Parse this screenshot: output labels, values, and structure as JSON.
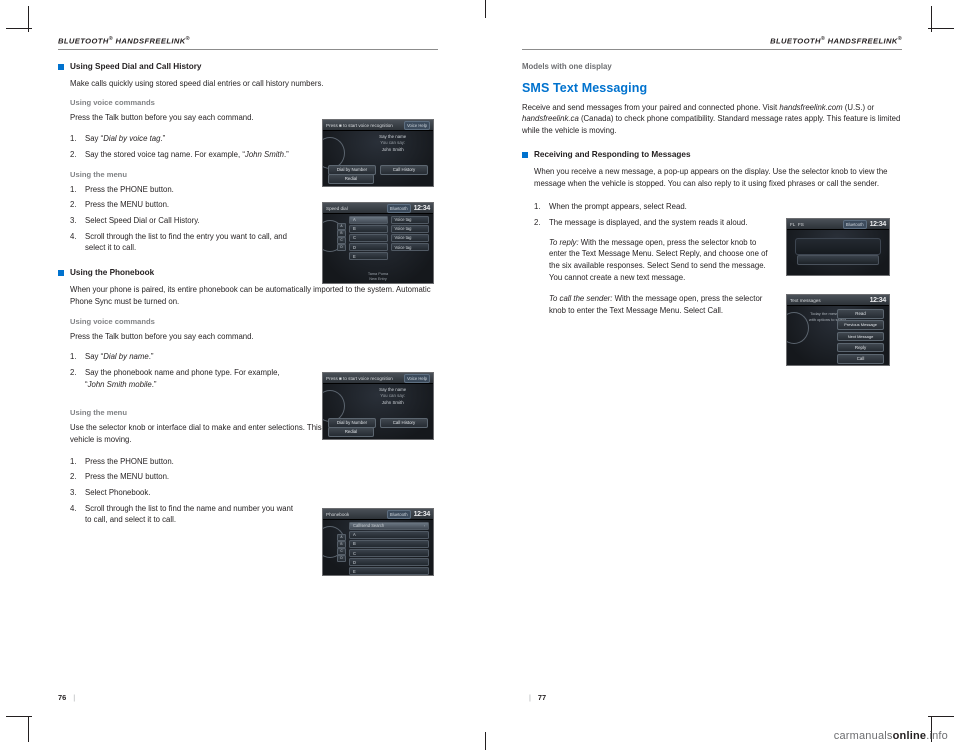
{
  "header": {
    "left": "BLUETOOTH",
    "left_sup": "®",
    "left_rest": " HANDSFREELINK",
    "left_sup2": "®",
    "right": "BLUETOOTH",
    "right_sup": "®",
    "right_rest": " HANDSFREELINK",
    "right_sup2": "®"
  },
  "left_page": {
    "folio": "76",
    "folio_bar": "|",
    "s1": {
      "title": "Using Speed Dial and Call History",
      "intro": "Make calls quickly using stored speed dial entries or call history numbers.",
      "voice_label": "Using voice commands",
      "voice_intro": "Press the Talk button before you say each command.",
      "voice_steps": [
        {
          "num": "1.",
          "pre": "Say “",
          "ital": "Dial by voice tag",
          "post": ".”"
        },
        {
          "num": "2.",
          "pre": "Say the stored voice tag name. For example, “",
          "ital": "John Smith",
          "post": ".”"
        }
      ],
      "menu_label": "Using the menu",
      "menu_steps": [
        {
          "num": "1.",
          "text": "Press the PHONE button."
        },
        {
          "num": "2.",
          "text": "Press the MENU button."
        },
        {
          "num": "3.",
          "text": "Select Speed Dial or Call History."
        },
        {
          "num": "4.",
          "text": "Scroll through the list to find the entry you want to call, and select it to call."
        }
      ]
    },
    "s2": {
      "title": "Using the Phonebook",
      "intro": "When your phone is paired, its entire phonebook can be automatically imported to the system. Automatic Phone Sync must be turned on.",
      "voice_label": "Using voice commands",
      "voice_intro": "Press the Talk button before you say each command.",
      "voice_steps": [
        {
          "num": "1.",
          "pre": "Say “",
          "ital": "Dial by name",
          "post": ".”"
        },
        {
          "num": "2.",
          "pre": "Say the phonebook name and phone type. For example, “",
          "ital": "John Smith mobile",
          "post": ".”"
        }
      ],
      "menu_label": "Using the menu",
      "menu_intro": "Use the selector knob or interface dial to make and enter selections. This method is inoperable while the vehicle is moving.",
      "menu_steps": [
        {
          "num": "1.",
          "text": "Press the PHONE button."
        },
        {
          "num": "2.",
          "text": "Press the MENU button."
        },
        {
          "num": "3.",
          "text": "Select Phonebook."
        },
        {
          "num": "4.",
          "text": "Scroll through the list to find the name and number you want to call, and select it to call."
        }
      ]
    },
    "screens": {
      "voice1": {
        "title": "Press ■ to start voice recognition",
        "badge": "Voice Help",
        "line1": "Say the name",
        "line2": "You can say:",
        "line3": "John Smith",
        "btn1": "Dial by Number",
        "btn2": "Call History",
        "btn3": "Redial"
      },
      "speeddial": {
        "title": "Speed dial",
        "sig": "Bluetooth",
        "clock": "12:34",
        "rows": [
          "A",
          "B",
          "C",
          "D",
          "E"
        ],
        "right_rows": [
          "Voice tag",
          "Voice tag",
          "Voice tag",
          "Voice tag"
        ],
        "footer1": "Tama Puma",
        "footer2": "New Entry"
      },
      "voice2": {
        "title": "Press ■ to start voice recognition",
        "badge": "Voice Help",
        "line1": "Say the name",
        "line2": "You can say:",
        "line3": "John Smith",
        "btn1": "Dial by Number",
        "btn2": "Call History",
        "btn3": "Redial"
      },
      "phonebook": {
        "title": "Phonebook",
        "sig": "Bluetooth",
        "clock": "12:34",
        "search": "Call/send Search",
        "rows": [
          "A",
          "B",
          "C",
          "D",
          "E"
        ]
      }
    }
  },
  "right_page": {
    "folio": "77",
    "folio_bar": "|",
    "models_label": "Models with one display",
    "section_title": "SMS Text Messaging",
    "intro_a": "Receive and send messages from your paired and connected phone. Visit ",
    "intro_ital1": "handsfreelink.com",
    "intro_b": " (U.S.) or ",
    "intro_ital2": "handsfreelink.ca",
    "intro_c": " (Canada) to check phone compatibility. Standard message rates apply. This feature is limited while the vehicle is moving.",
    "sub_title": "Receiving and Responding to Messages",
    "sub_intro": "When you receive a new message, a pop-up appears on the display. Use the selector knob to view the message when the vehicle is stopped. You can also reply to it using fixed phrases or call the sender.",
    "steps": [
      {
        "num": "1.",
        "text": "When the prompt appears, select Read."
      },
      {
        "num": "2.",
        "text": "The message is displayed, and the system reads it aloud."
      }
    ],
    "para_reply_ital": "To reply:",
    "para_reply": " With the message open, press the selector knob to enter the Text Message Menu. Select Reply, and choose one of the six available responses. Select Send to send the message. You cannot create a new text message.",
    "para_call_ital": "To call the sender:",
    "para_call": " With the message open, press the selector knob to enter the Text Message Menu. Select Call.",
    "screens": {
      "media": {
        "left1": "FL",
        "left2": "FS",
        "sig": "Bluetooth",
        "clock": "12:34"
      },
      "textmsg": {
        "title": "Text messages",
        "clock": "12:34",
        "left1": "Today the message",
        "left2": "with options to select",
        "btn1": "Read",
        "btn2": "Previous Message",
        "btn3": "Next Message",
        "btn4": "Reply",
        "btn5": "Call"
      }
    }
  },
  "watermark": {
    "a": "carmanuals",
    "b": "online",
    "c": ".info"
  }
}
